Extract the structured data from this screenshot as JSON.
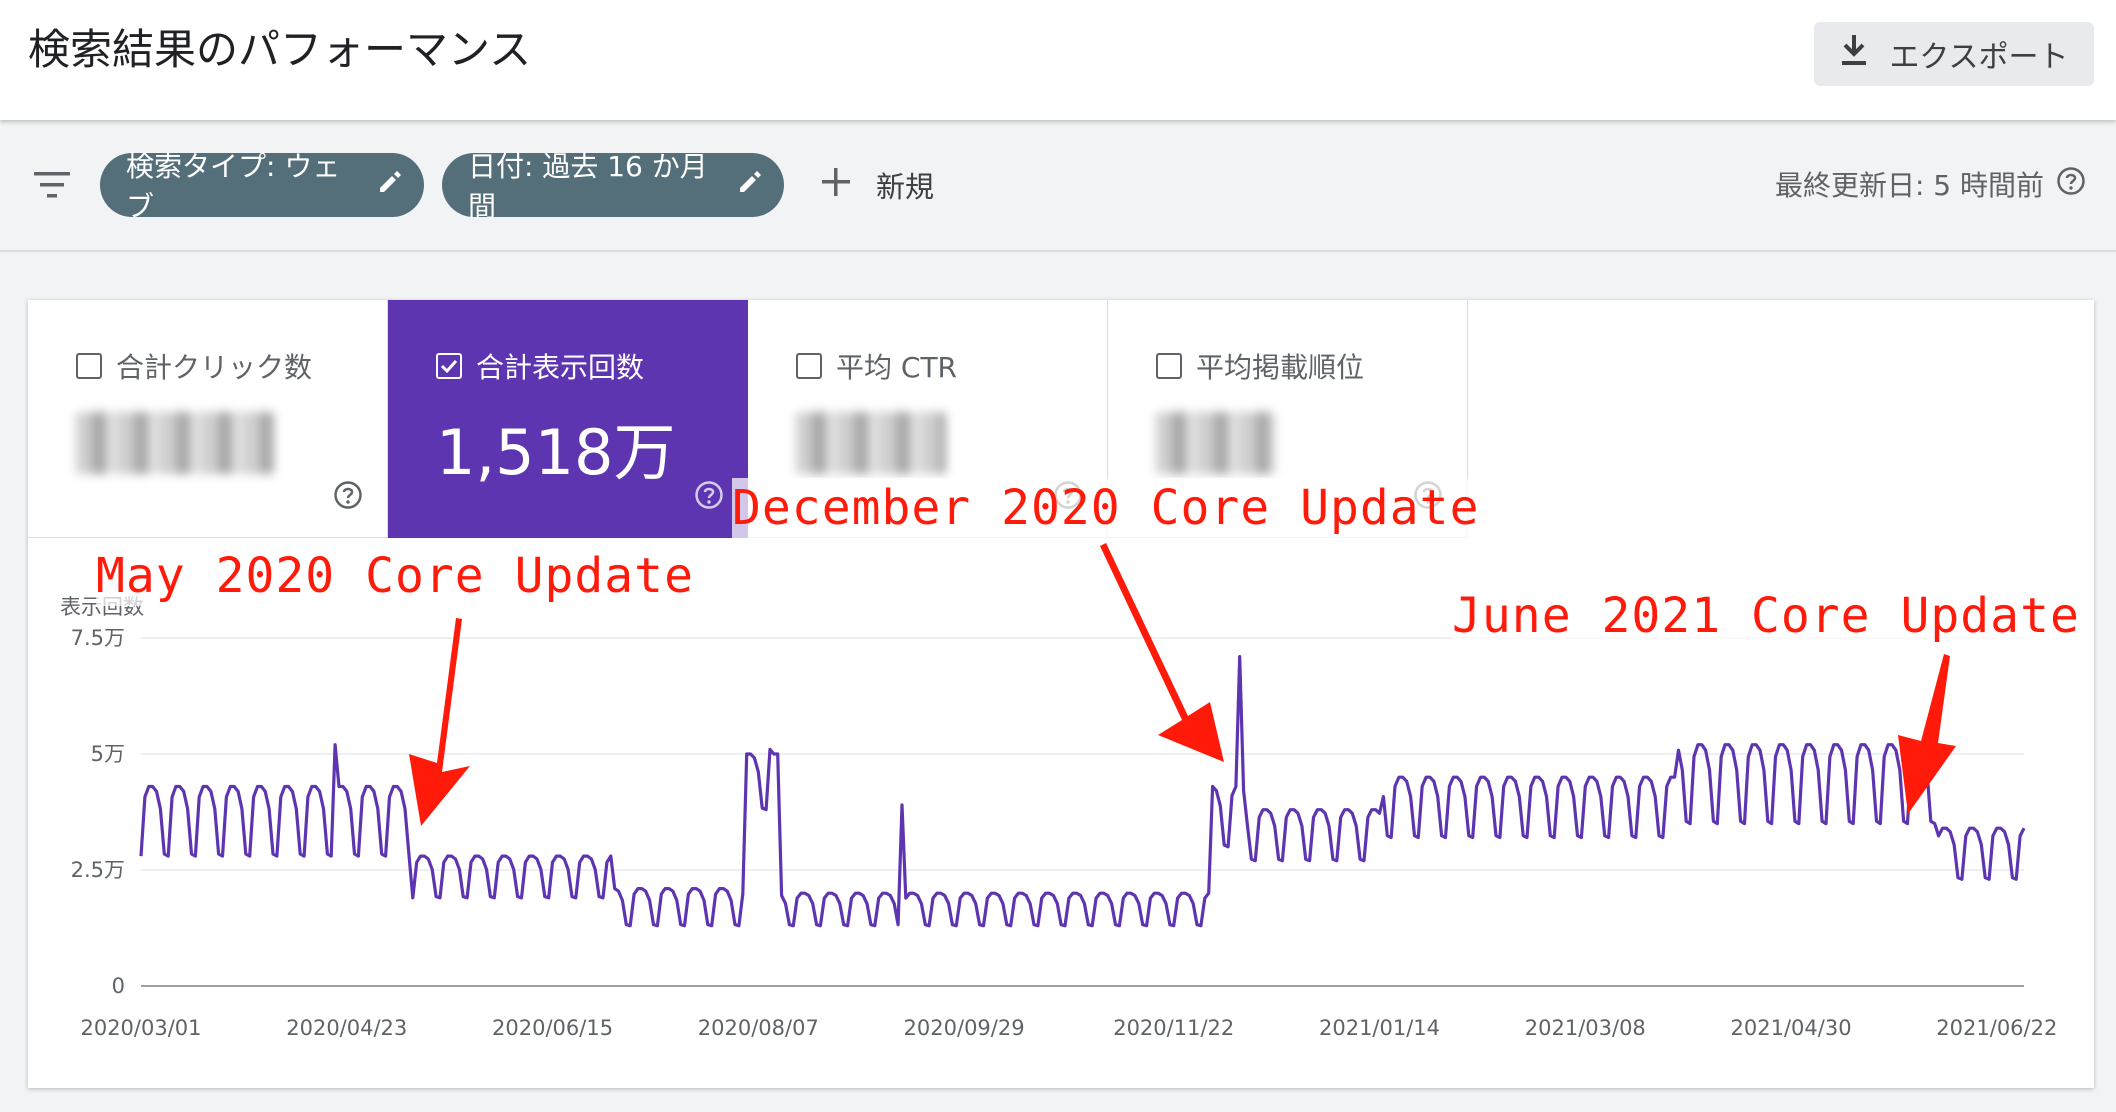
{
  "header": {
    "title": "検索結果のパフォーマンス",
    "export_label": "エクスポート"
  },
  "filters": {
    "chip1": "検索タイプ: ウェブ",
    "chip2": "日付: 過去 16 か月間",
    "new_label": "新規",
    "last_updated": "最終更新日: 5 時間前"
  },
  "metrics": [
    {
      "label": "合計クリック数",
      "checked": false,
      "value": ""
    },
    {
      "label": "合計表示回数",
      "checked": true,
      "value": "1,518万"
    },
    {
      "label": "平均 CTR",
      "checked": false,
      "value": ""
    },
    {
      "label": "平均掲載順位",
      "checked": false,
      "value": ""
    }
  ],
  "colors": {
    "accent": "#5e35b1",
    "chip": "#546e7a",
    "annotation": "#ff1a0a"
  },
  "annotations": [
    {
      "text": "May 2020 Core Update"
    },
    {
      "text": "December 2020 Core Update"
    },
    {
      "text": "June 2021 Core Update"
    }
  ],
  "chart_data": {
    "type": "line",
    "ylabel": "表示回数",
    "ylim": [
      0,
      75000
    ],
    "y_ticks": [
      {
        "value": 0,
        "label": "0"
      },
      {
        "value": 25000,
        "label": "2.5万"
      },
      {
        "value": 50000,
        "label": "5万"
      },
      {
        "value": 75000,
        "label": "7.5万"
      }
    ],
    "x_ticks": [
      "2020/03/01",
      "2020/04/23",
      "2020/06/15",
      "2020/08/07",
      "2020/09/29",
      "2020/11/22",
      "2021/01/14",
      "2021/03/08",
      "2021/04/30",
      "2021/06/22"
    ],
    "x_start": "2020/03/01",
    "x_end": "2021/06/29",
    "grid": true,
    "legend": "none",
    "series": [
      {
        "color": "#5e35b1",
        "segments": [
          {
            "start": "2020/03/01",
            "end": "2020/05/09",
            "high": 43000,
            "low": 28000
          },
          {
            "start": "2020/05/10",
            "end": "2020/06/30",
            "high": 28000,
            "low": 19000
          },
          {
            "start": "2020/07/01",
            "end": "2020/08/03",
            "high": 21000,
            "low": 13000
          },
          {
            "start": "2020/08/04",
            "end": "2020/08/12",
            "high": 50000,
            "low": 38000
          },
          {
            "start": "2020/08/13",
            "end": "2020/12/01",
            "high": 20000,
            "low": 13000
          },
          {
            "start": "2020/12/02",
            "end": "2020/12/10",
            "high": 43000,
            "low": 30000
          },
          {
            "start": "2020/12/11",
            "end": "2021/01/14",
            "high": 38000,
            "low": 27000
          },
          {
            "start": "2021/01/15",
            "end": "2021/03/31",
            "high": 45000,
            "low": 32000
          },
          {
            "start": "2021/04/01",
            "end": "2021/06/06",
            "high": 52000,
            "low": 35000
          },
          {
            "start": "2021/06/07",
            "end": "2021/06/29",
            "high": 34000,
            "low": 23000
          }
        ],
        "spikes": [
          {
            "date": "2020/04/20",
            "value": 52000
          },
          {
            "date": "2020/08/10",
            "value": 51000
          },
          {
            "date": "2020/09/13",
            "value": 39000
          },
          {
            "date": "2020/12/09",
            "value": 71000
          }
        ]
      }
    ]
  }
}
